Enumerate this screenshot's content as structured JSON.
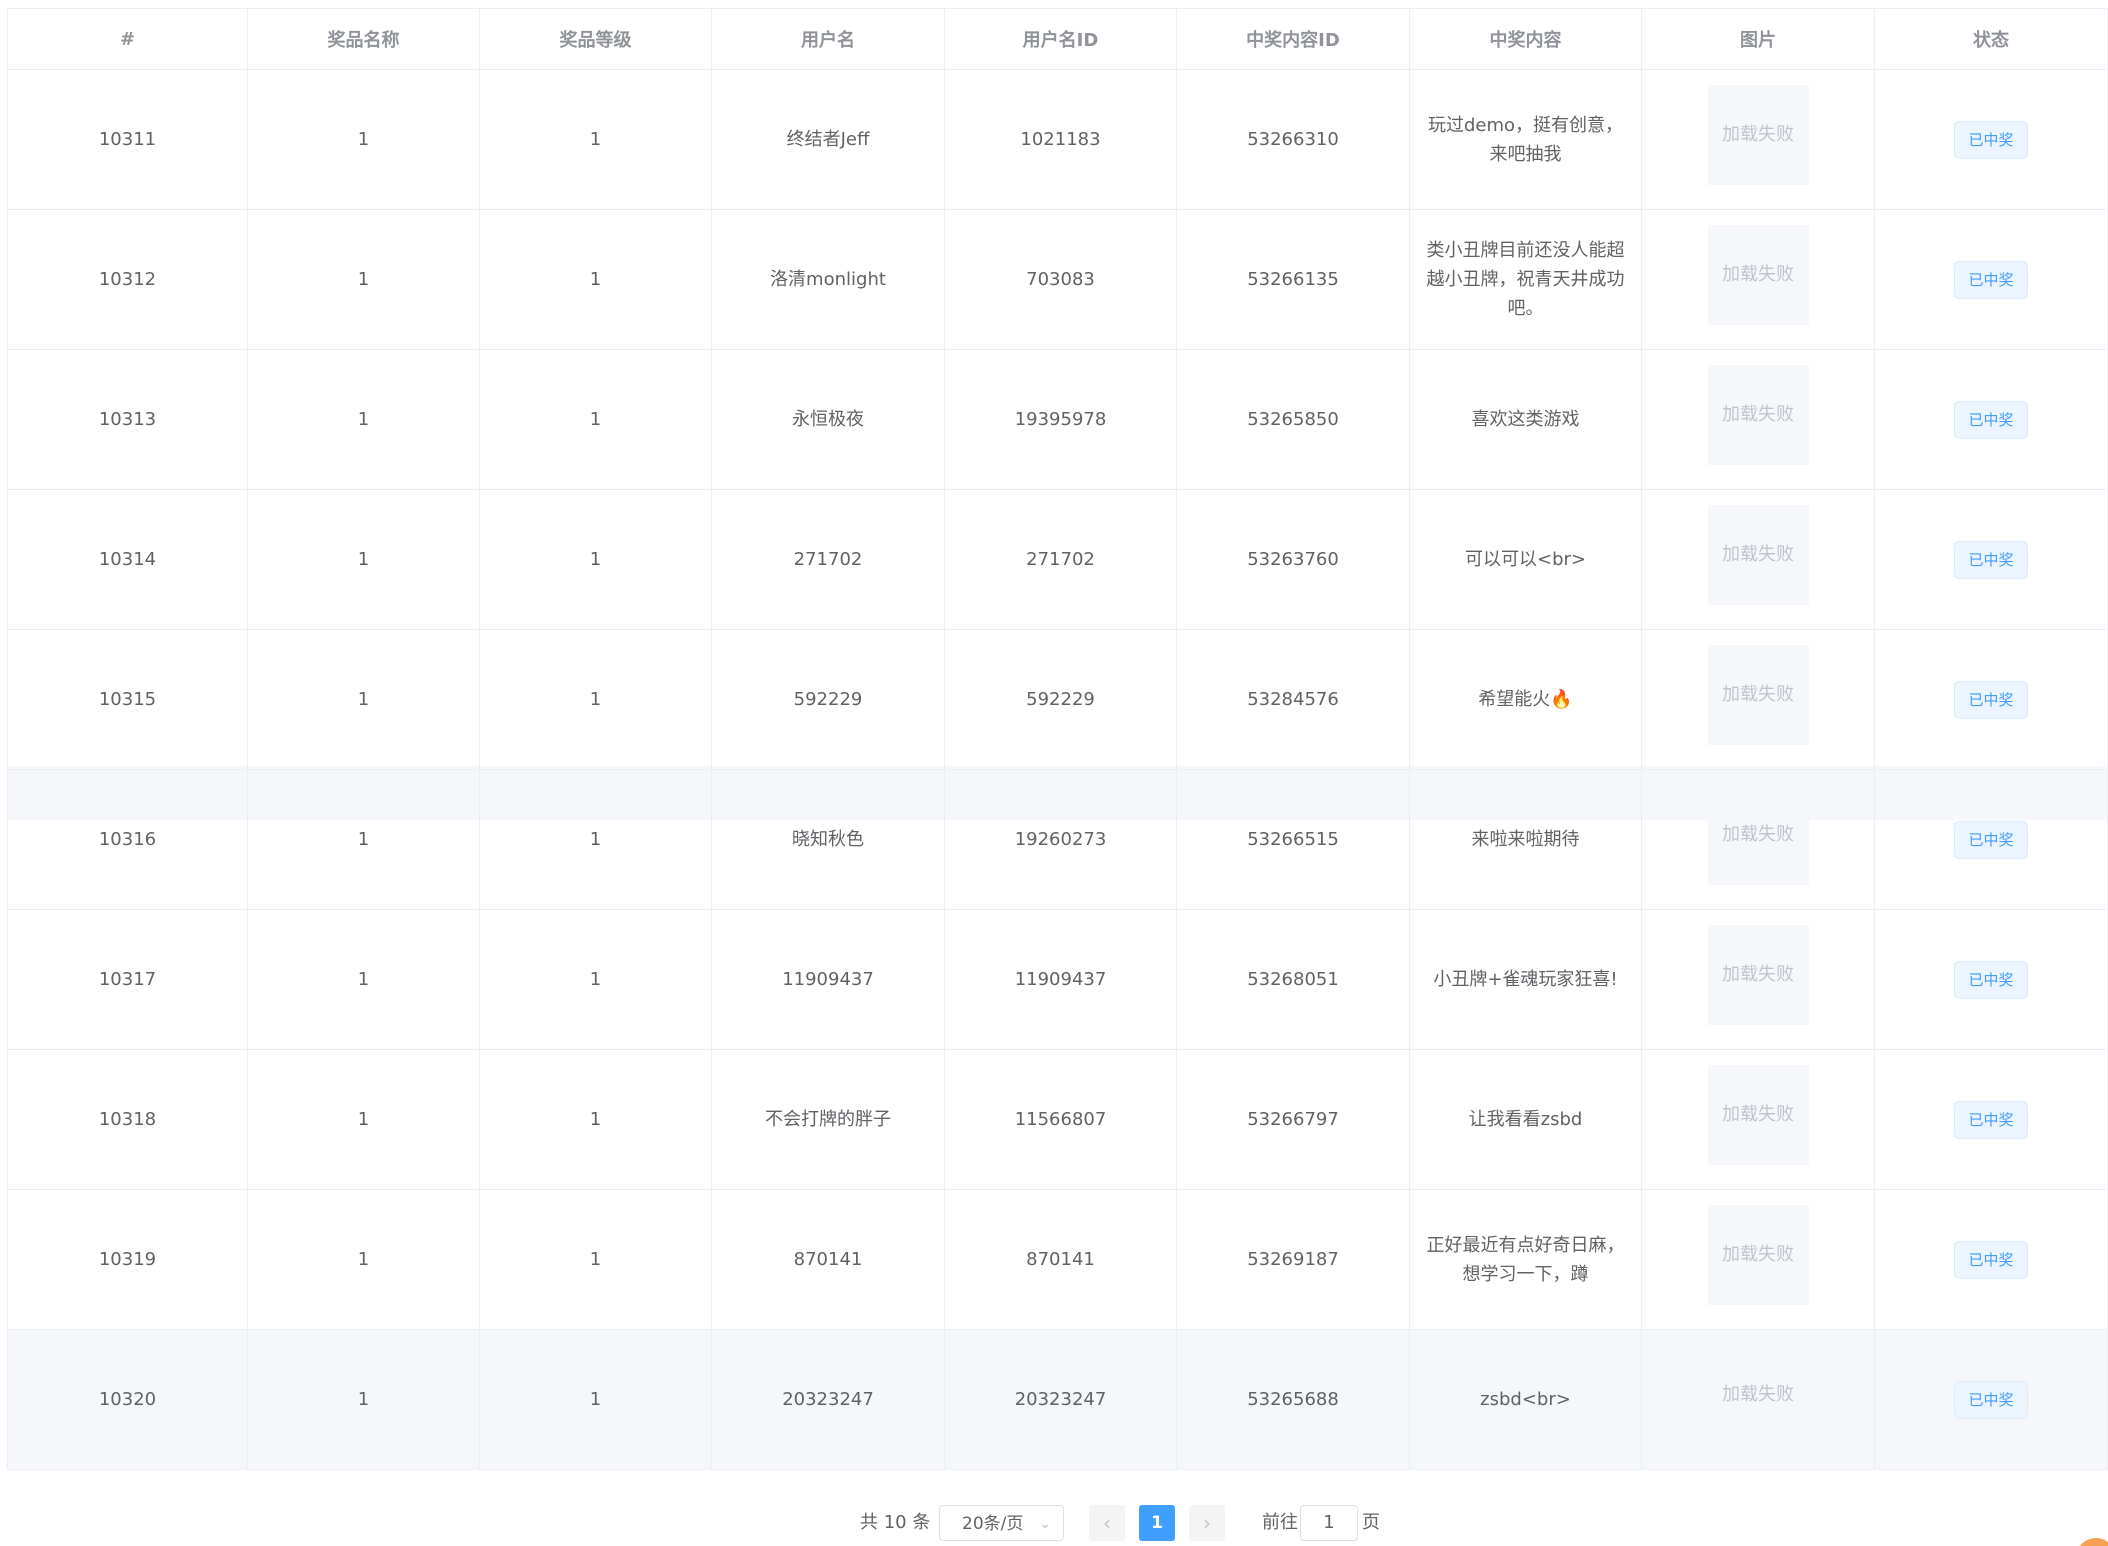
{
  "table": {
    "headers": [
      "#",
      "奖品名称",
      "奖品等级",
      "用户名",
      "用户名ID",
      "中奖内容ID",
      "中奖内容",
      "图片",
      "状态"
    ],
    "rows": [
      {
        "id": "10311",
        "prize_name": "1",
        "prize_level": "1",
        "username": "终结者Jeff",
        "user_id": "1021183",
        "content_id": "53266310",
        "content": "玩过demo，挺有创意，来吧抽我",
        "image": "加载失败",
        "status": "已中奖"
      },
      {
        "id": "10312",
        "prize_name": "1",
        "prize_level": "1",
        "username": "洛清monlight",
        "user_id": "703083",
        "content_id": "53266135",
        "content": "类小丑牌目前还没人能超越小丑牌，祝青天井成功吧。",
        "image": "加载失败",
        "status": "已中奖"
      },
      {
        "id": "10313",
        "prize_name": "1",
        "prize_level": "1",
        "username": "永恒极夜",
        "user_id": "19395978",
        "content_id": "53265850",
        "content": "喜欢这类游戏",
        "image": "加载失败",
        "status": "已中奖"
      },
      {
        "id": "10314",
        "prize_name": "1",
        "prize_level": "1",
        "username": "271702",
        "user_id": "271702",
        "content_id": "53263760",
        "content": "可以可以<br>",
        "image": "加载失败",
        "status": "已中奖"
      },
      {
        "id": "10315",
        "prize_name": "1",
        "prize_level": "1",
        "username": "592229",
        "user_id": "592229",
        "content_id": "53284576",
        "content": "希望能火🔥",
        "image": "加载失败",
        "status": "已中奖"
      },
      {
        "id": "10316",
        "prize_name": "1",
        "prize_level": "1",
        "username": "晓知秋色",
        "user_id": "19260273",
        "content_id": "53266515",
        "content": "来啦来啦期待",
        "image": "加载失败",
        "status": "已中奖"
      },
      {
        "id": "10317",
        "prize_name": "1",
        "prize_level": "1",
        "username": "11909437",
        "user_id": "11909437",
        "content_id": "53268051",
        "content": "小丑牌+雀魂玩家狂喜!",
        "image": "加载失败",
        "status": "已中奖"
      },
      {
        "id": "10318",
        "prize_name": "1",
        "prize_level": "1",
        "username": "不会打牌的胖子",
        "user_id": "11566807",
        "content_id": "53266797",
        "content": "让我看看zsbd",
        "image": "加载失败",
        "status": "已中奖"
      },
      {
        "id": "10319",
        "prize_name": "1",
        "prize_level": "1",
        "username": "870141",
        "user_id": "870141",
        "content_id": "53269187",
        "content": "正好最近有点好奇日麻，想学习一下，蹲",
        "image": "加载失败",
        "status": "已中奖"
      },
      {
        "id": "10320",
        "prize_name": "1",
        "prize_level": "1",
        "username": "20323247",
        "user_id": "20323247",
        "content_id": "53265688",
        "content": "zsbd<br>",
        "image": "加载失败",
        "status": "已中奖"
      }
    ]
  },
  "pagination": {
    "total_text": "共 10 条",
    "page_size": "20条/页",
    "current_page": "1",
    "goto_label": "前往",
    "goto_value": "1",
    "goto_suffix": "页"
  },
  "colors": {
    "accent": "#409eff",
    "tag_bg": "#ecf5ff",
    "header_text": "#909399",
    "cell_text": "#606266",
    "border": "#ebeef5",
    "hover_row": "#f5f7fa"
  }
}
